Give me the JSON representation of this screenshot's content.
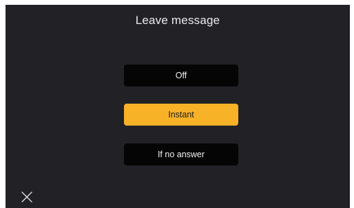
{
  "screen": {
    "title": "Leave message"
  },
  "options": [
    {
      "label": "Off",
      "selected": false
    },
    {
      "label": "Instant",
      "selected": true
    },
    {
      "label": "If no answer",
      "selected": false
    }
  ],
  "controls": {
    "close_icon": "close-icon"
  },
  "colors": {
    "background": "#222125",
    "option_background": "#050505",
    "selected_background": "#f7b228",
    "text": "#ececec"
  }
}
